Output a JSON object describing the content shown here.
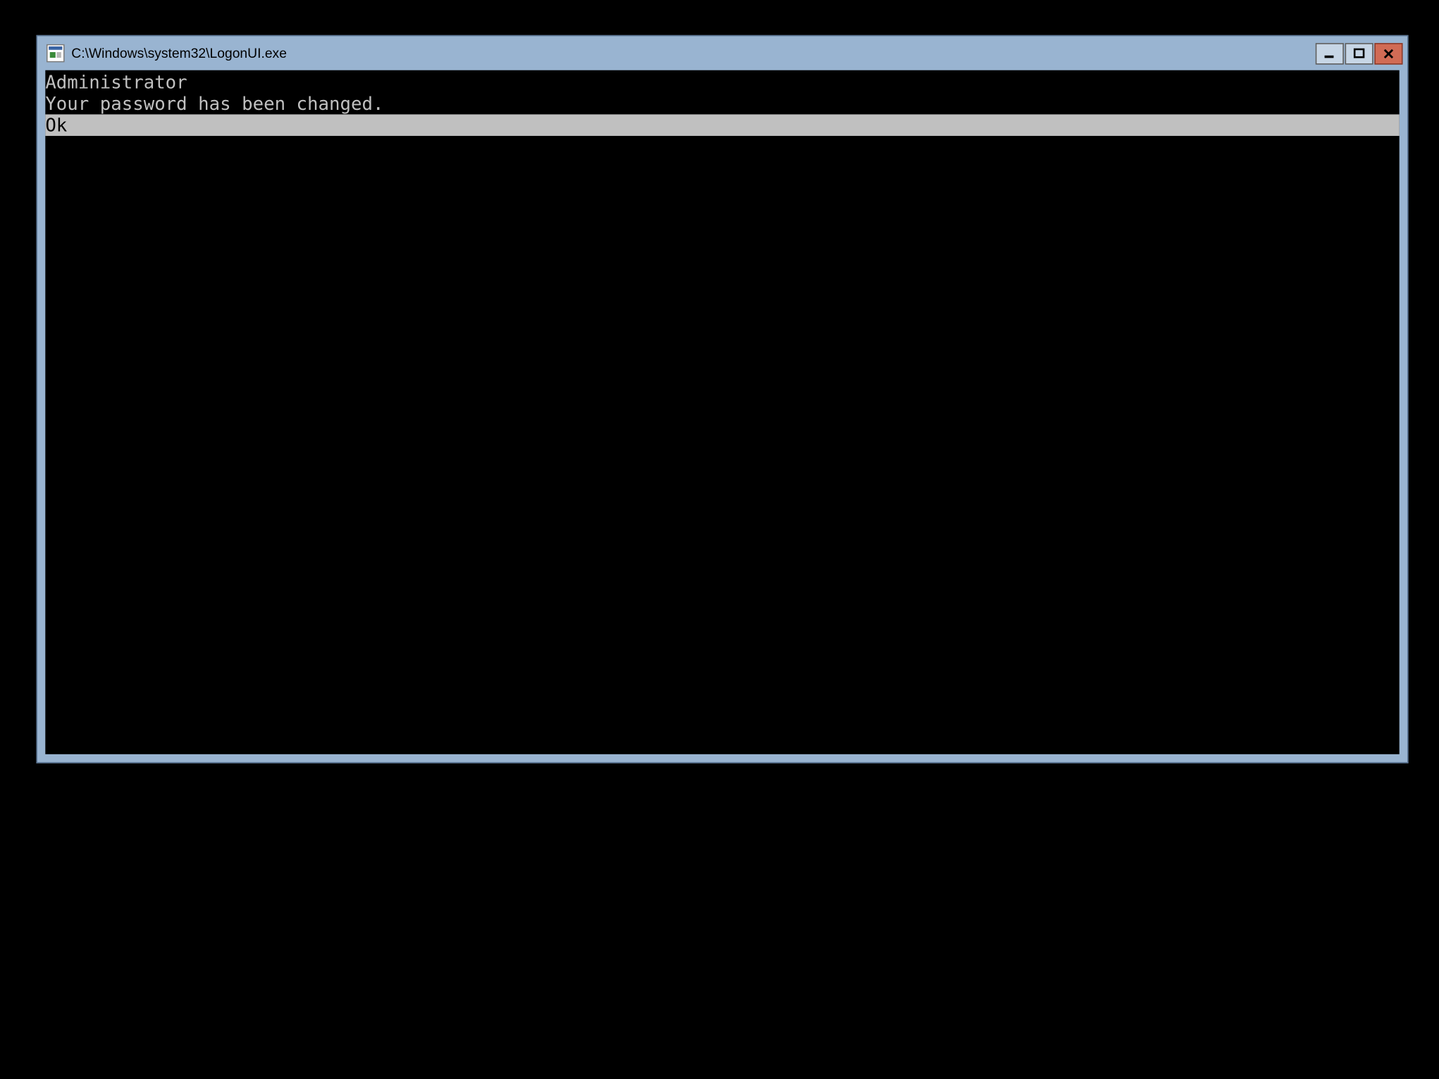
{
  "window": {
    "title": "C:\\Windows\\system32\\LogonUI.exe"
  },
  "console": {
    "line1": "Administrator",
    "line2": "Your password has been changed.",
    "ok_label": "Ok"
  }
}
